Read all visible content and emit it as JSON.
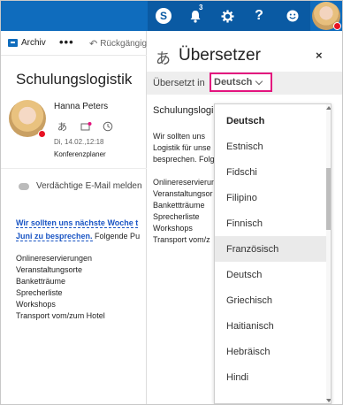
{
  "topbar": {
    "bell_count": "3",
    "help_label": "?",
    "icons": [
      "skype-icon",
      "bell-icon",
      "gear-icon",
      "help-icon",
      "smiley-icon",
      "avatar"
    ]
  },
  "toolbar": {
    "archive_label": "Archiv",
    "more_label": "•••",
    "undo_label": "Rückgängig"
  },
  "message": {
    "subject": "Schulungslogistik",
    "sender": "Hanna Peters",
    "date": "Di, 14.02.,12:18",
    "planner": "Konferenzplaner",
    "junk_label": "Verdächtige E-Mail melden",
    "body_link_1": "Wir sollten uns nächste Woche t",
    "body_link_2": "Juni zu besprechen.",
    "body_rest_2": " Folgende Pu",
    "list": [
      "Onlinereservierungen",
      "Veranstaltungsorte",
      "Banketträume",
      "Sprecherliste",
      "Workshops",
      "Transport vom/zum Hotel"
    ]
  },
  "translator": {
    "title": "Übersetzer",
    "close_label": "×",
    "translated_in_label": "Übersetzt in",
    "selected_language": "Deutsch",
    "subject": "Schulungslogi",
    "body_lines": [
      "Wir sollten uns",
      "Logistik für unse",
      "besprechen. Folg"
    ],
    "list": [
      "Onlinereservierun",
      "Veranstaltungsor",
      "Bankettträume",
      "Sprecherliste",
      "Workshops",
      "Transport vom/z"
    ]
  },
  "dropdown": {
    "options": [
      "Deutsch",
      "Estnisch",
      "Fidschi",
      "Filipino",
      "Finnisch",
      "Französisch",
      "Deutsch",
      "Griechisch",
      "Haitianisch",
      "Hebräisch",
      "Hindi"
    ]
  },
  "colors": {
    "suite_blue": "#0f6cbd",
    "select_outline": "#e3147e",
    "presence_busy": "#e81123",
    "link": "#1a55c4"
  }
}
